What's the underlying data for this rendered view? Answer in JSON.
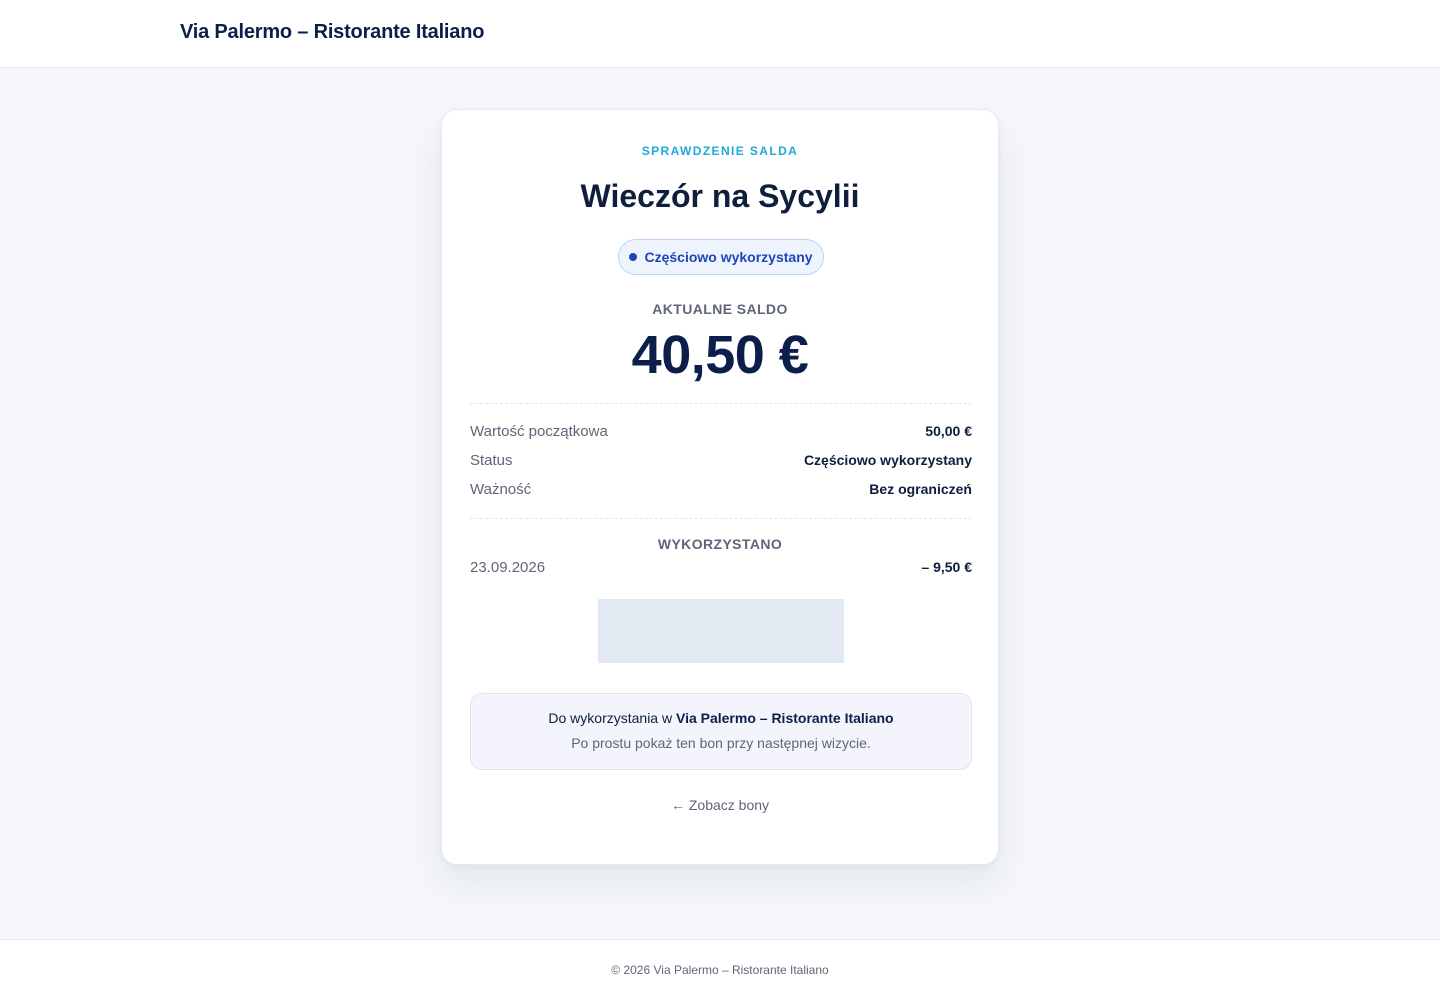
{
  "header": {
    "brand": "Via Palermo – Ristorante Italiano"
  },
  "voucher": {
    "eyebrow": "SPRAWDZENIE SALDA",
    "title": "Wieczór na Sycylii",
    "status_badge": "Częściowo wykorzystany",
    "balance_label": "AKTUALNE SALDO",
    "balance_amount": "40,50 €",
    "details": [
      {
        "label": "Wartość początkowa",
        "value": "50,00 €"
      },
      {
        "label": "Status",
        "value": "Częściowo wykorzystany"
      },
      {
        "label": "Ważność",
        "value": "Bez ograniczeń"
      }
    ],
    "used_label": "WYKORZYSTANO",
    "transactions": [
      {
        "date": "23.09.2026",
        "amount": "– 9,50 €"
      }
    ],
    "info_prefix": "Do wykorzystania w",
    "info_venue": "Via Palermo – Ristorante Italiano",
    "info_hint": "Po prostu pokaż ten bon przy następnej wizycie.",
    "back_link": "← Zobacz bony"
  },
  "footer": {
    "copyright": "© 2026 Via Palermo – Ristorante Italiano"
  },
  "colors": {
    "brand_navy": "#0b1f4a",
    "accent_cyan": "#1eaad8",
    "badge_blue": "#1f45b8",
    "page_bg": "#f5f7fb"
  }
}
